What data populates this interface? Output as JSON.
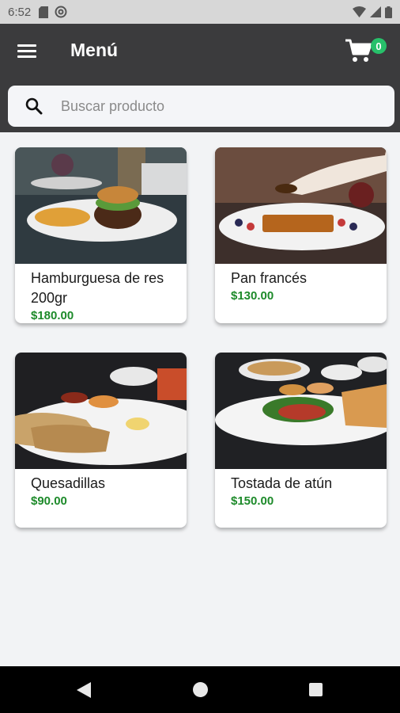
{
  "status_bar": {
    "time": "6:52"
  },
  "app_bar": {
    "title": "Menú",
    "cart_count": "0"
  },
  "search": {
    "placeholder": "Buscar producto",
    "value": ""
  },
  "products": [
    {
      "name": "Hamburguesa de res 200gr",
      "price": "$180.00"
    },
    {
      "name": "Pan francés",
      "price": "$130.00"
    },
    {
      "name": "Quesadillas",
      "price": "$90.00"
    },
    {
      "name": "Tostada de atún",
      "price": "$150.00"
    }
  ],
  "colors": {
    "app_bar": "#3b3b3d",
    "price": "#1d8a2a",
    "cart_badge": "#27c06a",
    "background": "#f2f3f5"
  },
  "icons": {
    "menu": "menu-icon",
    "cart": "cart-icon",
    "search": "search-icon"
  }
}
